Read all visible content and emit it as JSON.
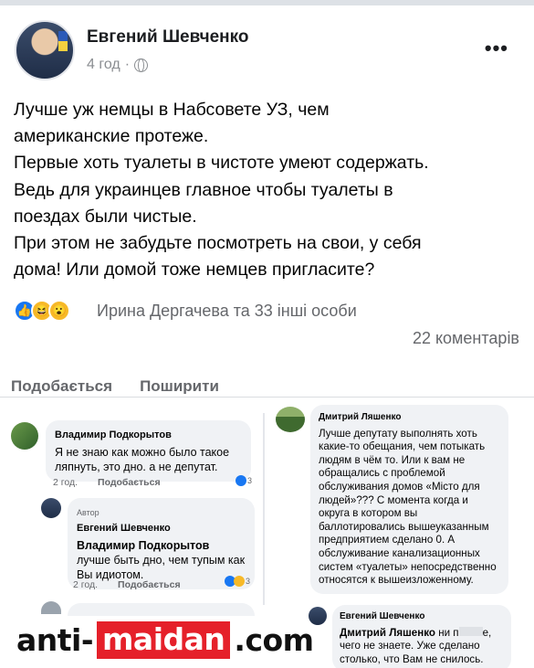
{
  "post": {
    "author": "Евгений Шевченко",
    "time": "4 год",
    "more": "•••",
    "text_lines": [
      "Лучше уж немцы в Набсовете УЗ, чем",
      "американские протеже.",
      "Первые хоть туалеты в чистоте умеют содержать.",
      "Ведь для украинцев главное чтобы туалеты в",
      "поездах были чистые.",
      "При этом не забудьте посмотреть на свои, у себя",
      "дома! Или домой тоже немцев пригласите?"
    ],
    "reactions_text": "Ирина Дергачева та 33 інші особи",
    "comments_count": "22 коментарів",
    "actions": {
      "like": "Подобається",
      "share": "Поширити"
    }
  },
  "comments": {
    "left": [
      {
        "name": "Владимир Подкорытов",
        "text": "Я не знаю как можно было такое ляпнуть, это дно. а не депутат.",
        "time": "2 год.",
        "like": "Подобається",
        "reactions": "3"
      },
      {
        "author_tag": "Автор",
        "name": "Евгений Шевченко",
        "mention": "Владимир Подкорытов",
        "text": "лучше быть дно, чем тупым как Вы идиотом.",
        "time": "2 год.",
        "like": "Подобається",
        "reactions": "3"
      }
    ],
    "right": [
      {
        "name": "Дмитрий Ляшенко",
        "text": "Лучше депутату выполнять хоть какие-то обещания, чем потыкать людям в чём то. Или к вам не обращались с проблемой обслуживания домов «Місто для людей»??? С момента когда и округа в котором вы баллотировались вышеуказанным предприятием сделано 0. А обслуживание канализационных систем «туалеты» непосредственно относятся к вышеизложенному."
      },
      {
        "name": "Евгений Шевченко",
        "mention": "Дмитрий Ляшенко",
        "text_part1": "ни п",
        "text_part2": "е, чего не знаете. Уже сделано столько, что Вам не снилось."
      }
    ]
  },
  "watermark": {
    "part1": "anti-",
    "part2": "maidan",
    "part3": ".com"
  }
}
